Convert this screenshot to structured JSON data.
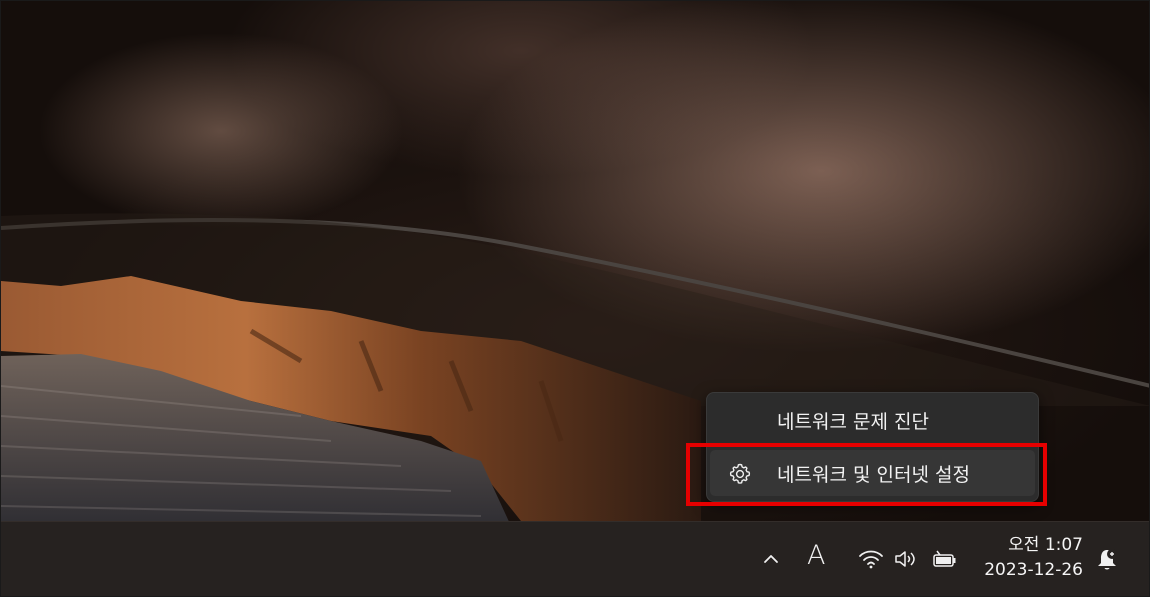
{
  "context_menu": {
    "items": [
      {
        "label": "네트워크 문제 진단",
        "icon": ""
      },
      {
        "label": "네트워크 및 인터넷 설정",
        "icon": "gear-icon"
      }
    ]
  },
  "taskbar": {
    "ime_indicator": "A",
    "clock": {
      "time": "오전 1:07",
      "date": "2023-12-26"
    },
    "tray_icons": [
      "chevron-up-icon",
      "wifi-icon",
      "volume-icon",
      "battery-icon",
      "notification-bell-icon"
    ]
  },
  "colors": {
    "highlight": "#e60000",
    "menu_bg": "#2c2c2c",
    "taskbar_bg": "#262220"
  }
}
